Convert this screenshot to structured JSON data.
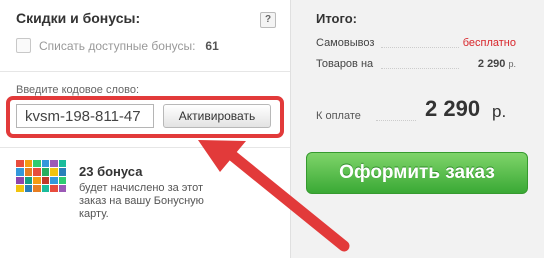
{
  "discounts": {
    "title": "Скидки и бонусы:",
    "help_label": "?",
    "checkbox_label": "Списать доступные бонусы:",
    "available_bonus": "61",
    "checked": false
  },
  "promo": {
    "label": "Введите кодовое слово:",
    "input_value": "kvsm-198-811-47",
    "activate_label": "Активировать"
  },
  "bonus_info": {
    "count": "23 бонуса",
    "description": "будет начислено за этот заказ на вашу Бонусную карту."
  },
  "summary": {
    "title": "Итого:",
    "pickup_label": "Самовывоз",
    "pickup_value": "бесплатно",
    "goods_label": "Товаров на",
    "goods_value": "2 290",
    "goods_currency": "р.",
    "pay_label": "К оплате",
    "pay_value": "2 290",
    "pay_currency": "р.",
    "order_button": "Оформить заказ"
  },
  "colors": {
    "accent_red": "#e23a3a",
    "free_red": "#d8262b",
    "button_green": "#3aa935"
  },
  "icons": {
    "bonus_card": "bonus-card-icon",
    "arrow": "red-arrow-annotation"
  }
}
